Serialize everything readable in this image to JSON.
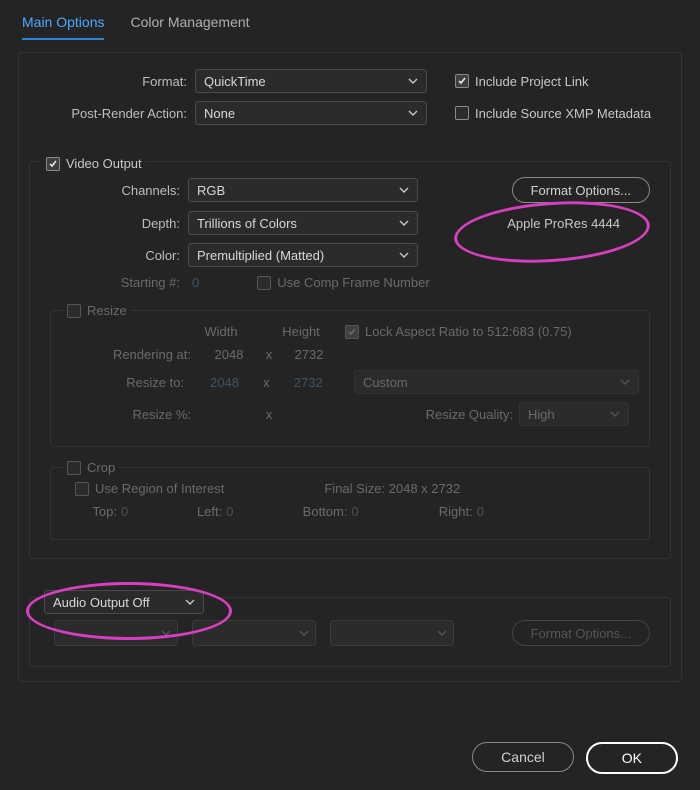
{
  "tabs": {
    "main": "Main Options",
    "color": "Color Management"
  },
  "format": {
    "label": "Format:",
    "value": "QuickTime",
    "include_link_label": "Include Project Link",
    "post_label": "Post-Render Action:",
    "post_value": "None",
    "include_xmp_label": "Include Source XMP Metadata"
  },
  "video": {
    "header": "Video Output",
    "channels_label": "Channels:",
    "channels_value": "RGB",
    "depth_label": "Depth:",
    "depth_value": "Trillions of Colors",
    "color_label": "Color:",
    "color_value": "Premultiplied (Matted)",
    "format_options_label": "Format Options...",
    "codec_text": "Apple ProRes 4444",
    "starting_label": "Starting #:",
    "starting_value": "0",
    "use_comp_label": "Use Comp Frame Number"
  },
  "resize": {
    "header": "Resize",
    "width_label": "Width",
    "height_label": "Height",
    "lock_label": "Lock Aspect Ratio to 512:683 (0.75)",
    "rendering_label": "Rendering at:",
    "rendering_w": "2048",
    "rendering_h": "2732",
    "resizeto_label": "Resize to:",
    "resizeto_w": "2048",
    "resizeto_h": "2732",
    "resizeto_preset": "Custom",
    "resizepct_label": "Resize %:",
    "quality_label": "Resize Quality:",
    "quality_value": "High",
    "x": "x"
  },
  "crop": {
    "header": "Crop",
    "roi_label": "Use Region of Interest",
    "finalsize_label": "Final Size: 2048 x 2732",
    "top_label": "Top:",
    "top_v": "0",
    "left_label": "Left:",
    "left_v": "0",
    "bottom_label": "Bottom:",
    "bottom_v": "0",
    "right_label": "Right:",
    "right_v": "0"
  },
  "audio": {
    "value": "Audio Output Off",
    "format_options_label": "Format Options..."
  },
  "buttons": {
    "cancel": "Cancel",
    "ok": "OK"
  }
}
